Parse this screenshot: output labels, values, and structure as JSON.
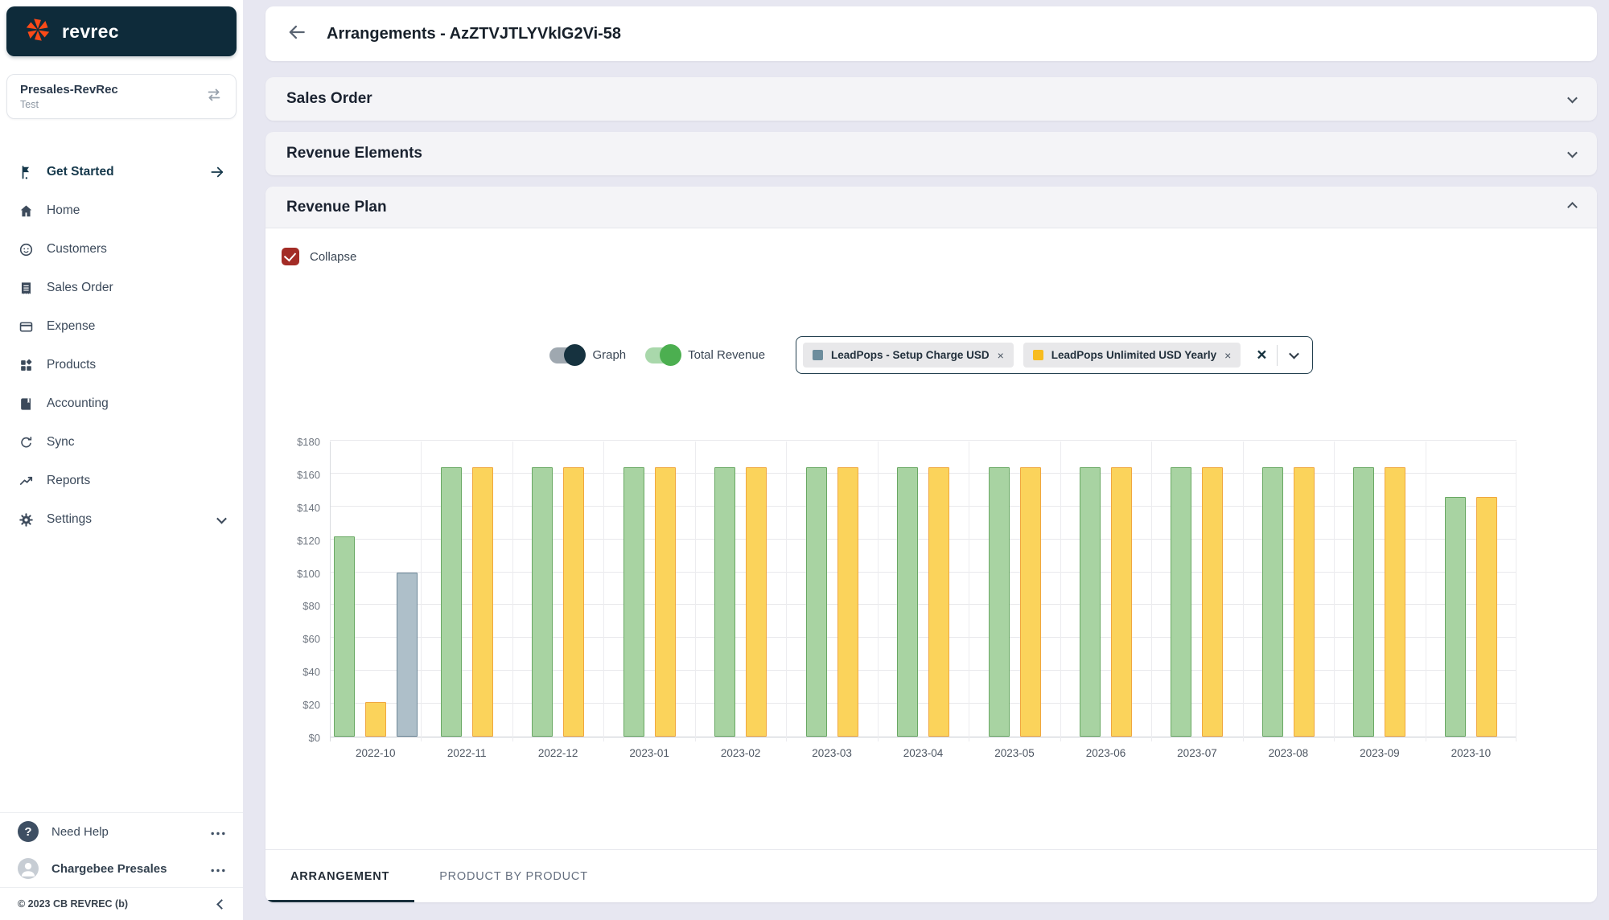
{
  "app": {
    "logo_text": "revrec"
  },
  "sidebar": {
    "workspace_name": "Presales-RevRec",
    "workspace_env": "Test",
    "get_started_label": "Get Started",
    "items": [
      {
        "label": "Home"
      },
      {
        "label": "Customers"
      },
      {
        "label": "Sales Order"
      },
      {
        "label": "Expense"
      },
      {
        "label": "Products"
      },
      {
        "label": "Accounting"
      },
      {
        "label": "Sync"
      },
      {
        "label": "Reports"
      },
      {
        "label": "Settings"
      }
    ],
    "need_help_label": "Need Help",
    "help_glyph": "?",
    "user_name": "Chargebee Presales",
    "copyright": "© 2023 CB REVREC (b)"
  },
  "header": {
    "title": "Arrangements - AzZTVJTLYVklG2Vi-58"
  },
  "sections": {
    "sales_order_title": "Sales Order",
    "revenue_elements_title": "Revenue Elements",
    "revenue_plan_title": "Revenue Plan"
  },
  "revenue_plan": {
    "collapse_label": "Collapse",
    "graph_toggle": {
      "label": "Graph",
      "on": true
    },
    "total_revenue_toggle": {
      "label": "Total Revenue",
      "on": true
    },
    "filter_chips": [
      {
        "label": "LeadPops - Setup Charge USD",
        "swatch": "#6D8D9D"
      },
      {
        "label": "LeadPops Unlimited USD Yearly",
        "swatch": "#F7BC1F"
      }
    ],
    "chip_remove_glyph": "×",
    "clear_glyph": "×",
    "tabs": [
      {
        "label": "ARRANGEMENT",
        "active": true
      },
      {
        "label": "PRODUCT BY PRODUCT",
        "active": false
      }
    ]
  },
  "chart_data": {
    "type": "bar",
    "title": "",
    "categories": [
      "2022-10",
      "2022-11",
      "2022-12",
      "2023-01",
      "2023-02",
      "2023-03",
      "2023-04",
      "2023-05",
      "2023-06",
      "2023-07",
      "2023-08",
      "2023-09",
      "2023-10"
    ],
    "series": [
      {
        "name": "Total Revenue",
        "color": "#A8D3A2",
        "border": "#69A863",
        "values": [
          122,
          164,
          164,
          164,
          164,
          164,
          164,
          164,
          164,
          164,
          164,
          164,
          146
        ]
      },
      {
        "name": "LeadPops Unlimited USD Yearly",
        "color": "#FBD35B",
        "border": "#F0A73F",
        "values": [
          21,
          164,
          164,
          164,
          164,
          164,
          164,
          164,
          164,
          164,
          164,
          164,
          146
        ]
      },
      {
        "name": "LeadPops - Setup Charge USD",
        "color": "#AEBFC9",
        "border": "#6E8898",
        "values": [
          100,
          0,
          0,
          0,
          0,
          0,
          0,
          0,
          0,
          0,
          0,
          0,
          0
        ]
      }
    ],
    "ylim": [
      0,
      180
    ],
    "ytick_step": 20,
    "ytick_prefix": "$",
    "grid": true,
    "legend": "none",
    "xlabel": "",
    "ylabel": ""
  },
  "colors": {
    "accent_navy": "#16323F",
    "background": "#E7E7F1",
    "checkbox_red": "#A32C26",
    "toggle_green": "#4CAF50",
    "logo_orange": "#FB4A18",
    "bar_green": "#A8D3A2",
    "bar_yellow": "#FBD35B",
    "bar_gray": "#AEBFC9"
  }
}
